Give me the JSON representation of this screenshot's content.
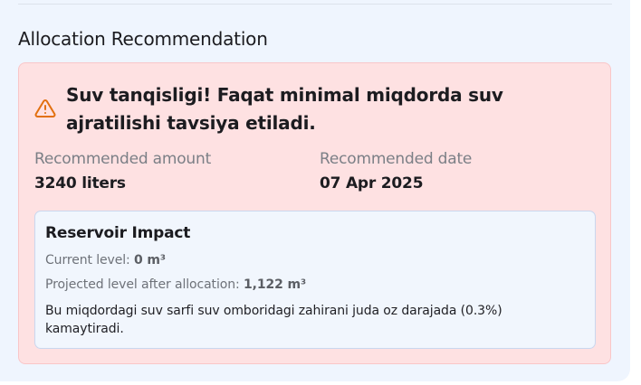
{
  "section": {
    "title": "Allocation Recommendation"
  },
  "alert": {
    "icon": "warning-triangle-icon",
    "message": "Suv tanqisligi! Faqat minimal miqdorda suv ajratilishi tavsiya etiladi.",
    "accent_color": "#e2700f",
    "background_color": "#fee1e2"
  },
  "recommendation": {
    "amount_label": "Recommended amount",
    "amount_value": "3240 liters",
    "date_label": "Recommended date",
    "date_value": "07 Apr 2025"
  },
  "impact": {
    "title": "Reservoir Impact",
    "current_label": "Current level:",
    "current_value": "0 m³",
    "projected_label": "Projected level after allocation:",
    "projected_value": "1,122 m³",
    "note": "Bu miqdordagi suv sarfi suv omboridagi zahirani juda oz darajada (0.3%) kamaytiradi."
  }
}
